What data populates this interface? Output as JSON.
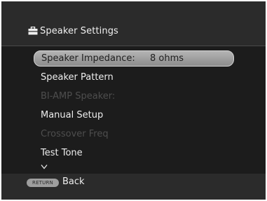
{
  "header": {
    "title": "Speaker Settings",
    "icon": "toolbox-icon"
  },
  "menu": {
    "items": [
      {
        "label": "Speaker Impedance:",
        "value": "8 ohms",
        "state": "selected"
      },
      {
        "label": "Speaker Pattern",
        "state": "enabled"
      },
      {
        "label": "BI-AMP Speaker:",
        "state": "disabled"
      },
      {
        "label": "Manual Setup",
        "state": "enabled"
      },
      {
        "label": "Crossover Freq",
        "state": "disabled"
      },
      {
        "label": "Test Tone",
        "state": "enabled"
      }
    ],
    "more_indicator": "chevron-down-icon"
  },
  "footer": {
    "return_button": "RETURN",
    "back_label": "Back"
  },
  "colors": {
    "background": "#1c1c1c",
    "header_bar": "#2b2b2b",
    "highlight": "#a0a0a0",
    "text": "#eeeeee",
    "disabled_text": "#4e4e4e"
  }
}
